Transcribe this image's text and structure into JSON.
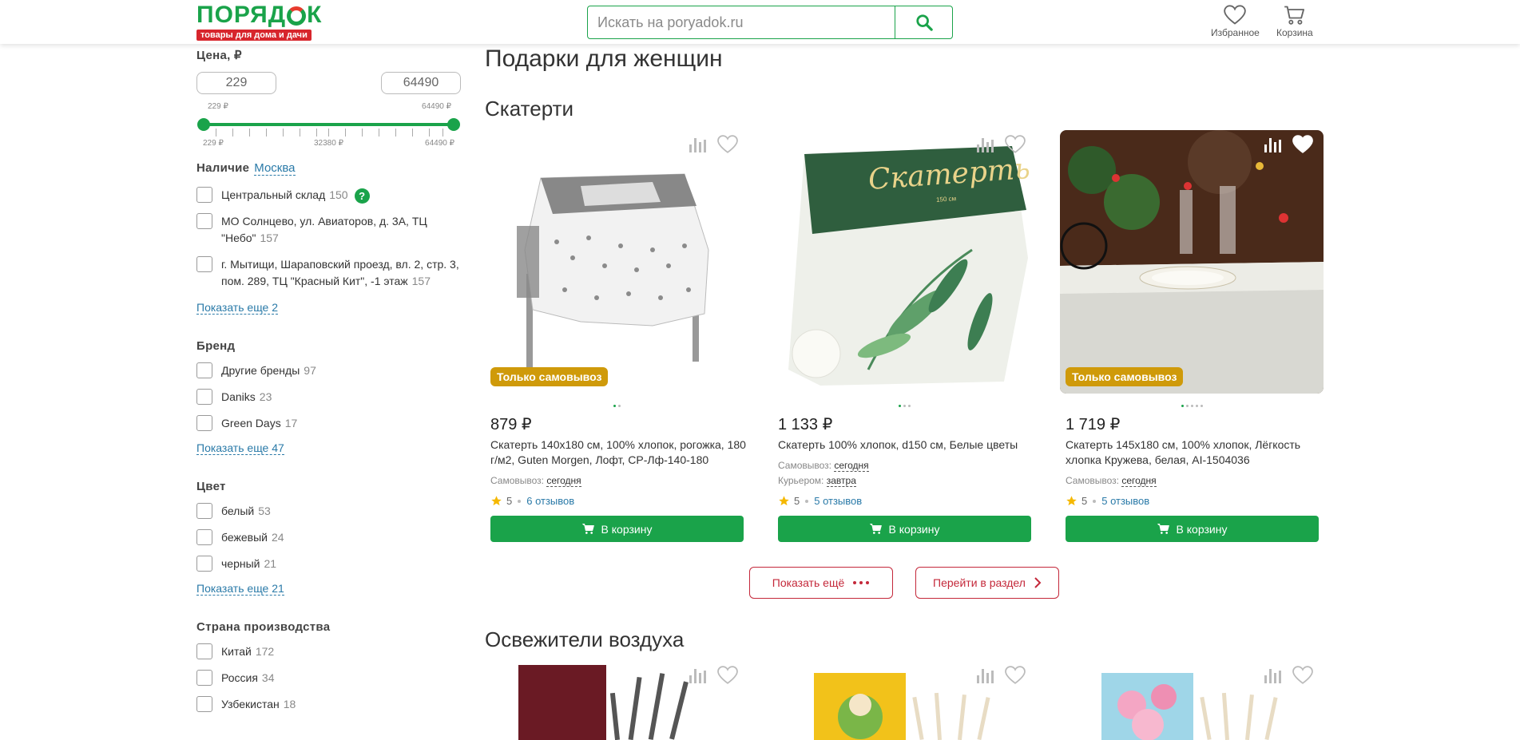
{
  "header": {
    "logo_word_left": "ПОРЯД",
    "logo_word_right": "К",
    "logo_tagline": "товары для дома и дачи",
    "search_placeholder": "Искать на poryadok.ru",
    "favorites_label": "Избранное",
    "cart_label": "Корзина",
    "accent_color": "#1aa34a"
  },
  "sidebar": {
    "price": {
      "title": "Цена, ₽",
      "min_input": "229",
      "max_input": "64490",
      "min_label": "229 ₽",
      "max_label": "64490 ₽",
      "scale_min": "229 ₽",
      "scale_mid": "32380 ₽",
      "scale_max": "64490 ₽"
    },
    "availability": {
      "title": "Наличие",
      "city": "Москва",
      "items": [
        {
          "label": "Центральный склад",
          "count": "150",
          "help": "?"
        },
        {
          "label": "МО Солнцево, ул. Авиаторов, д. 3А, ТЦ \"Небо\"",
          "count": "157"
        },
        {
          "label": "г. Мытищи, Шараповский проезд, вл. 2, стр. 3, пом. 289, ТЦ \"Красный Кит\", -1 этаж",
          "count": "157"
        }
      ],
      "more": "Показать еще 2"
    },
    "brand": {
      "title": "Бренд",
      "items": [
        {
          "label": "Другие бренды",
          "count": "97"
        },
        {
          "label": "Daniks",
          "count": "23"
        },
        {
          "label": "Green Days",
          "count": "17"
        }
      ],
      "more": "Показать еще 47"
    },
    "color": {
      "title": "Цвет",
      "items": [
        {
          "label": "белый",
          "count": "53"
        },
        {
          "label": "бежевый",
          "count": "24"
        },
        {
          "label": "черный",
          "count": "21"
        }
      ],
      "more": "Показать еще 21"
    },
    "country": {
      "title": "Страна производства",
      "items": [
        {
          "label": "Китай",
          "count": "172"
        },
        {
          "label": "Россия",
          "count": "34"
        },
        {
          "label": "Узбекистан",
          "count": "18"
        }
      ]
    }
  },
  "main": {
    "page_title": "Подарки для женщин",
    "section1": {
      "title": "Скатерти",
      "show_more": "Показать ещё",
      "go_section": "Перейти в раздел",
      "products": [
        {
          "price": "879 ₽",
          "name": "Скатерть 140х180 см, 100% хлопок, рогожка, 180 г/м2, Guten Morgen, Лофт, СР-Лф-140-180",
          "badge": "Только самовывоз",
          "pickup_label": "Самовывоз:",
          "pickup_value": "сегодня",
          "rating": "5",
          "reviews": "6 отзывов",
          "cart": "В корзину"
        },
        {
          "price": "1 133 ₽",
          "name": "Скатерть 100% хлопок, d150 см, Белые цветы",
          "pickup_label": "Самовывоз:",
          "pickup_value": "сегодня",
          "courier_label": "Курьером:",
          "courier_value": "завтра",
          "rating": "5",
          "reviews": "5 отзывов",
          "cart": "В корзину",
          "package_text": "Скатерть",
          "package_small": "150 см"
        },
        {
          "price": "1 719 ₽",
          "name": "Скатерть 145х180 см, 100% хлопок, Лёгкость хлопка Кружева, белая, AI-1504036",
          "badge": "Только самовывоз",
          "pickup_label": "Самовывоз:",
          "pickup_value": "сегодня",
          "rating": "5",
          "reviews": "5 отзывов",
          "cart": "В корзину"
        }
      ]
    },
    "section2": {
      "title": "Освежители воздуха"
    }
  }
}
